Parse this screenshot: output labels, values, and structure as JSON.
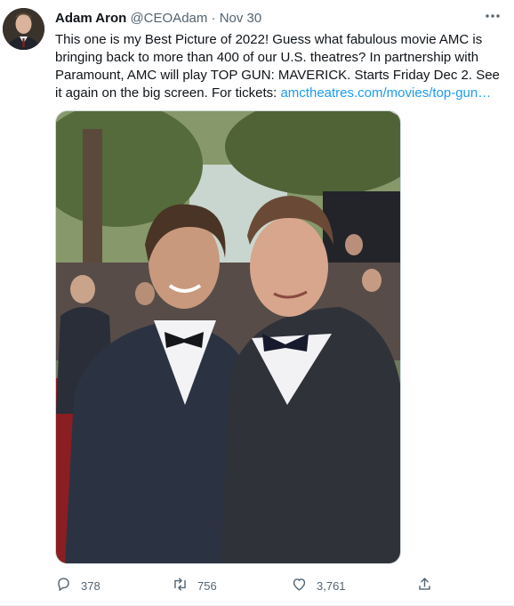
{
  "tweet": {
    "author_name": "Adam Aron",
    "author_handle": "@CEOAdam",
    "separator": "·",
    "timestamp": "Nov 30",
    "text": "This one is my Best Picture of 2022! Guess what fabulous movie AMC is bringing back to more than 400 of our U.S. theatres? In partnership with Paramount, AMC will play TOP GUN: MAVERICK. Starts Friday Dec 2. See it again on the big screen. For tickets: ",
    "link_text": "amctheatres.com/movies/top-gun…",
    "media_description": "",
    "stats": {
      "replies": "378",
      "retweets": "756",
      "likes": "3,761"
    }
  },
  "icons": {
    "more": "more-horizontal-icon",
    "reply": "reply-icon",
    "retweet": "retweet-icon",
    "like": "heart-icon",
    "share": "share-icon"
  },
  "colors": {
    "link": "#1d9bf0",
    "secondary_text": "#536471",
    "primary_text": "#0f1419"
  }
}
